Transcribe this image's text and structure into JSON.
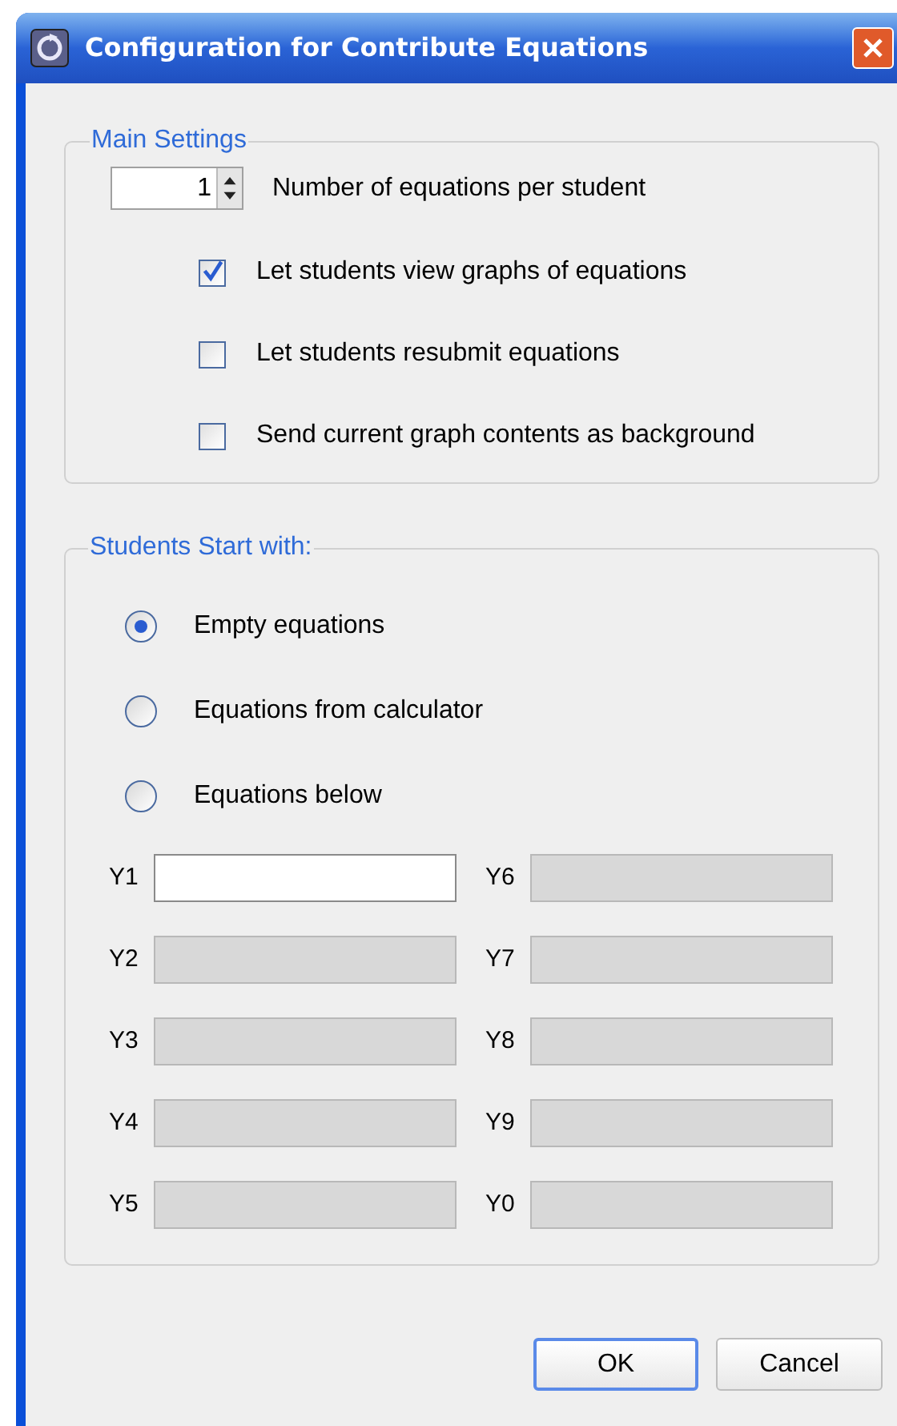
{
  "window": {
    "title": "Configuration for Contribute Equations"
  },
  "main_settings": {
    "title": "Main Settings",
    "spinner": {
      "value": "1",
      "label": "Number of equations per student"
    },
    "options": [
      {
        "label": "Let students view graphs of equations",
        "checked": true
      },
      {
        "label": "Let students resubmit equations",
        "checked": false
      },
      {
        "label": "Send current graph contents as background",
        "checked": false
      }
    ]
  },
  "start_with": {
    "title": "Students Start with:",
    "choices": [
      {
        "label": "Empty equations",
        "selected": true
      },
      {
        "label": "Equations from calculator",
        "selected": false
      },
      {
        "label": "Equations below",
        "selected": false
      }
    ],
    "equations": [
      {
        "label": "Y1",
        "disabled": false
      },
      {
        "label": "Y6",
        "disabled": true
      },
      {
        "label": "Y2",
        "disabled": true
      },
      {
        "label": "Y7",
        "disabled": true
      },
      {
        "label": "Y3",
        "disabled": true
      },
      {
        "label": "Y8",
        "disabled": true
      },
      {
        "label": "Y4",
        "disabled": true
      },
      {
        "label": "Y9",
        "disabled": true
      },
      {
        "label": "Y5",
        "disabled": true
      },
      {
        "label": "Y0",
        "disabled": true
      }
    ]
  },
  "buttons": [
    {
      "label": "OK",
      "kind": "default"
    },
    {
      "label": "Cancel",
      "kind": "normal"
    }
  ]
}
